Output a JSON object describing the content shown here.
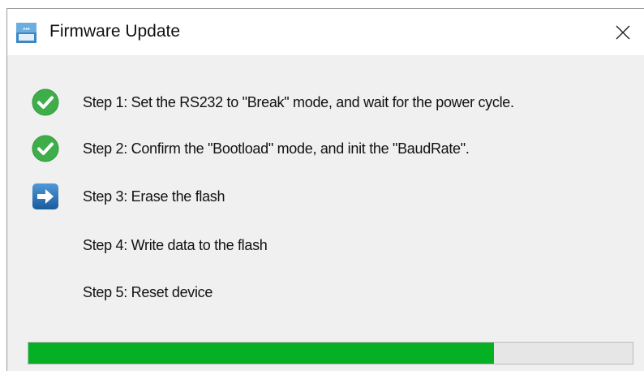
{
  "window": {
    "title": "Firmware Update",
    "app_icon": "firmware-app-icon",
    "close_icon": "close-icon"
  },
  "steps": [
    {
      "label": "Step 1: Set the RS232 to \"Break\" mode, and wait for the power cycle.",
      "status": "done",
      "icon": "check-circle-icon"
    },
    {
      "label": "Step 2: Confirm the \"Bootload\" mode, and init the \"BaudRate\".",
      "status": "done",
      "icon": "check-circle-icon"
    },
    {
      "label": "Step 3: Erase the flash",
      "status": "current",
      "icon": "arrow-right-icon"
    },
    {
      "label": "Step 4: Write data to the flash",
      "status": "pending",
      "icon": ""
    },
    {
      "label": "Step 5: Reset device",
      "status": "pending",
      "icon": ""
    }
  ],
  "progress": {
    "fraction": 0.77
  },
  "colors": {
    "check": "#3fae4a",
    "arrow_bg": "#1f6fb5",
    "progress_fill": "#06b025",
    "progress_track": "#e6e6e6"
  }
}
